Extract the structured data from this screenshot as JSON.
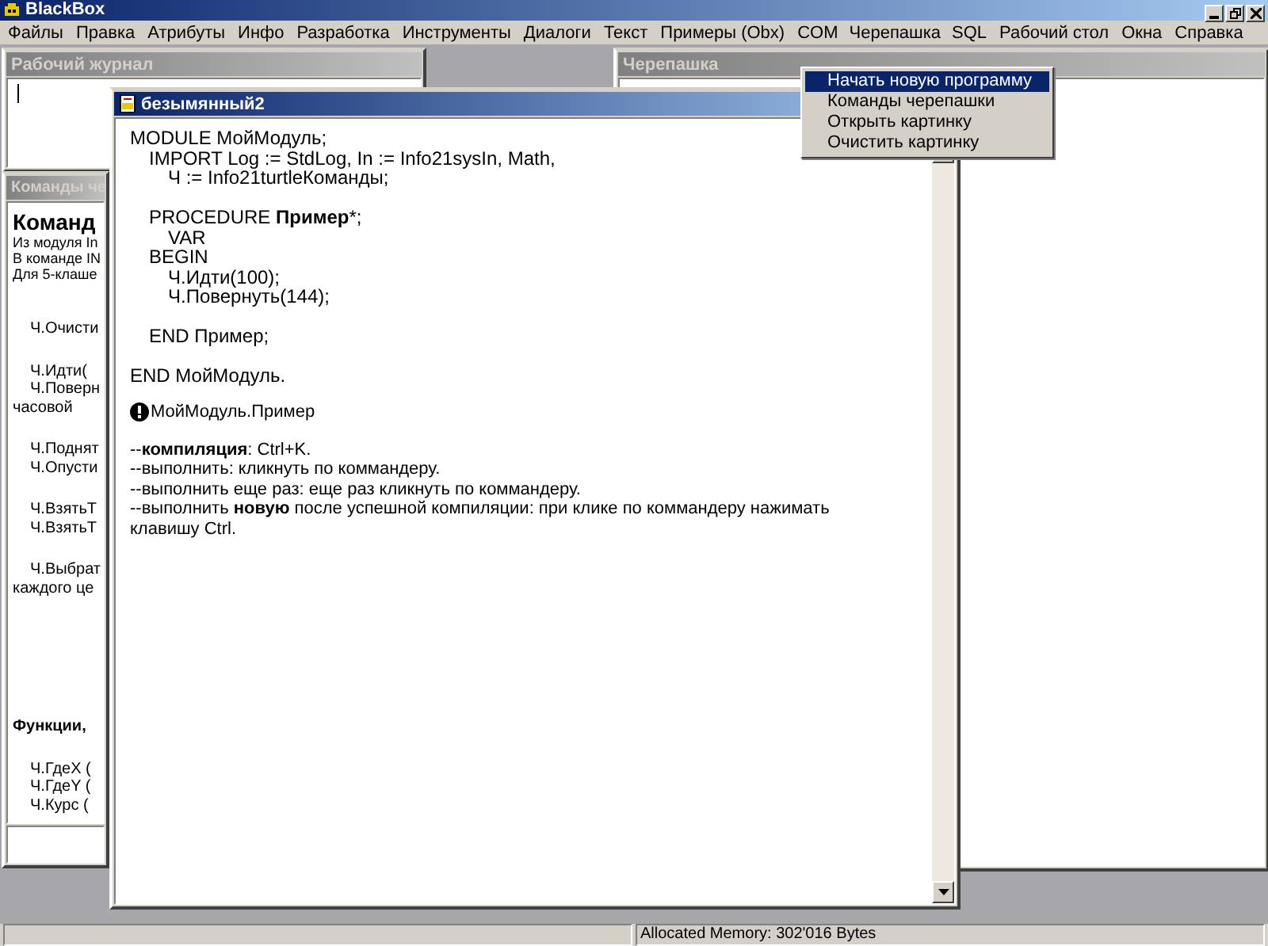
{
  "app": {
    "title": "BlackBox"
  },
  "menu": [
    {
      "label": "Файлы",
      "selected": false
    },
    {
      "label": "Правка",
      "selected": false
    },
    {
      "label": "Атрибуты",
      "selected": false
    },
    {
      "label": "Инфо",
      "selected": false
    },
    {
      "label": "Разработка",
      "selected": false
    },
    {
      "label": "Инструменты",
      "selected": false
    },
    {
      "label": "Диалоги",
      "selected": false
    },
    {
      "label": "Текст",
      "selected": false
    },
    {
      "label": "Примеры (Obx)",
      "selected": false
    },
    {
      "label": "COM",
      "selected": false
    },
    {
      "label": "Черепашка",
      "selected": true
    },
    {
      "label": "SQL",
      "selected": false
    },
    {
      "label": "Рабочий стол",
      "selected": false
    },
    {
      "label": "Окна",
      "selected": false
    },
    {
      "label": "Справка",
      "selected": false
    }
  ],
  "dropdown": [
    {
      "label": "Начать новую программу",
      "selected": true
    },
    {
      "label": "Команды черепашки",
      "selected": false
    },
    {
      "label": "Открыть картинку",
      "selected": false
    },
    {
      "label": "Очистить картинку",
      "selected": false
    }
  ],
  "log_window": {
    "title": "Рабочий журнал"
  },
  "commands_window": {
    "title": "Команды че",
    "heading": "Команд",
    "lines": [
      {
        "kind": "intro",
        "blank_before": false,
        "text": "Из модуля In"
      },
      {
        "kind": "intro",
        "blank_before": false,
        "text": "В команде IN"
      },
      {
        "kind": "intro",
        "blank_before": false,
        "text": "Для 5-клаше"
      },
      {
        "kind": "cmd",
        "blank_before": true,
        "text": "Ч.Очисти"
      },
      {
        "kind": "cmd",
        "blank_before": true,
        "text": "Ч.Идти("
      },
      {
        "kind": "cmd",
        "blank_before": false,
        "text": "Ч.Поверн"
      },
      {
        "kind": "cont",
        "blank_before": false,
        "text": "часовой"
      },
      {
        "kind": "cmd",
        "blank_before": true,
        "text": "Ч.Поднят"
      },
      {
        "kind": "cmd",
        "blank_before": false,
        "text": "Ч.Опусти"
      },
      {
        "kind": "cmd",
        "blank_before": true,
        "text": "Ч.ВзятьТ"
      },
      {
        "kind": "cmd",
        "blank_before": false,
        "text": "Ч.ВзятьТ"
      },
      {
        "kind": "cmd",
        "blank_before": true,
        "text": "Ч.Выбрат"
      },
      {
        "kind": "cont",
        "blank_before": false,
        "text": "каждого це"
      },
      {
        "kind": "bold",
        "blank_before": true,
        "text": "Функции,"
      },
      {
        "kind": "cmd",
        "blank_before": true,
        "text": "Ч.ГдеX ("
      },
      {
        "kind": "cmd",
        "blank_before": false,
        "text": "Ч.ГдеY ("
      },
      {
        "kind": "cmd",
        "blank_before": false,
        "text": "Ч.Курс ("
      }
    ]
  },
  "turtle_window": {
    "title": "Черепашка"
  },
  "editor_window": {
    "title": "безымянный2",
    "code": [
      {
        "text": "MODULE  МойМодуль;",
        "blank_before": false,
        "children": [
          {
            "text": "IMPORT  Log := StdLog,  In := Info21sysIn,  Math,",
            "blank_before": false,
            "children": [
              {
                "text": "Ч := Info21turtleКоманды;",
                "blank_before": false
              }
            ]
          },
          {
            "text": "PROCEDURE **Пример***;",
            "blank_before": true,
            "children": [
              {
                "text": "VAR",
                "blank_before": false
              }
            ]
          },
          {
            "text": "BEGIN",
            "blank_before": false,
            "children": [
              {
                "text": "Ч.Идти(100);",
                "blank_before": false
              },
              {
                "text": "Ч.Повернуть(144);",
                "blank_before": false
              }
            ]
          },
          {
            "text": "END Пример;",
            "blank_before": true
          }
        ]
      },
      {
        "text": "END МойМодуль.",
        "blank_before": true
      }
    ],
    "commander": "МойМодуль.Пример",
    "notes": [
      "--**компиляция**: Ctrl+K.",
      "--выполнить: кликнуть по коммандеру.",
      "--выполнить еще раз: еще раз кликнуть по коммандеру.",
      "--выполнить **новую** после успешной компиляции: при клике по коммандеру нажимать клавишу Ctrl."
    ]
  },
  "status_bar": {
    "memory": "Allocated Memory: 302'016 Bytes"
  }
}
